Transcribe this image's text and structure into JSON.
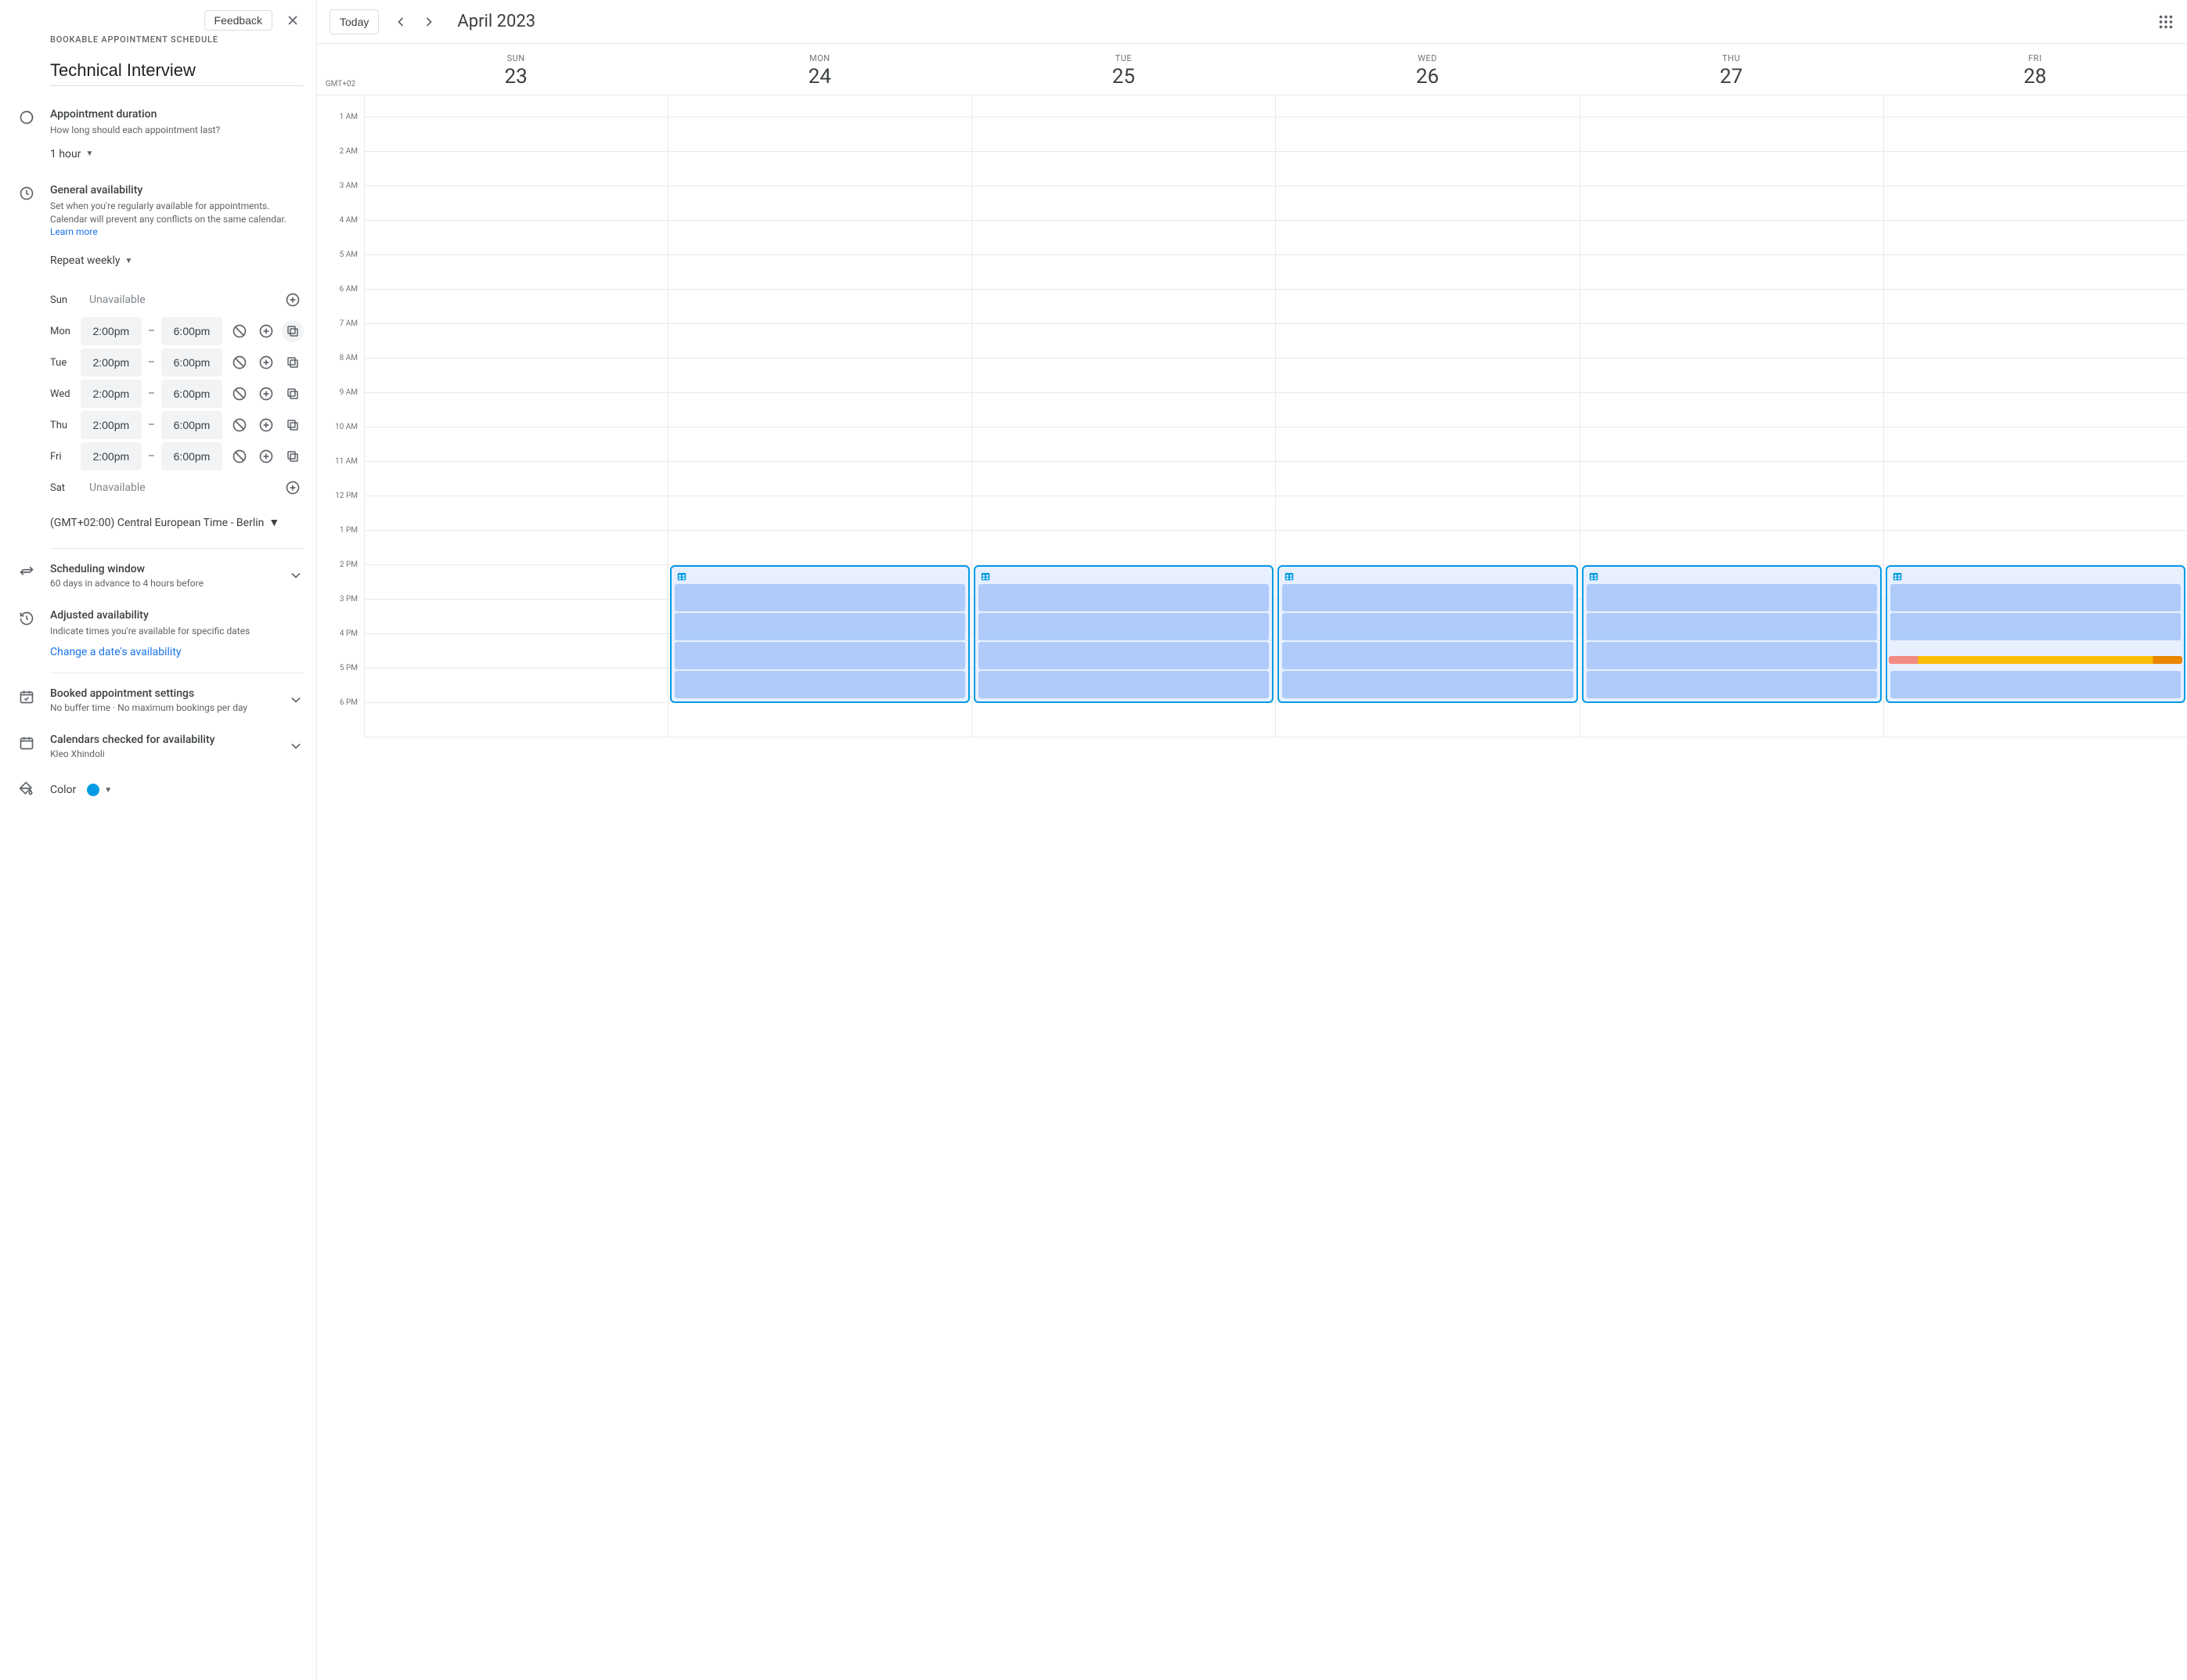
{
  "sidebar": {
    "feedback_label": "Feedback",
    "subhead": "Bookable Appointment Schedule",
    "title": "Technical Interview",
    "duration": {
      "title": "Appointment duration",
      "desc": "How long should each appointment last?",
      "value": "1 hour"
    },
    "availability": {
      "title": "General availability",
      "desc_a": "Set when you're regularly available for appointments. Calendar will prevent any conflicts on the same calendar. ",
      "learn_more": "Learn more",
      "repeat_value": "Repeat weekly",
      "days": [
        {
          "label": "Sun",
          "unavailable": true,
          "unavailable_text": "Unavailable"
        },
        {
          "label": "Mon",
          "start": "2:00pm",
          "end": "6:00pm",
          "copy_highlight": true
        },
        {
          "label": "Tue",
          "start": "2:00pm",
          "end": "6:00pm"
        },
        {
          "label": "Wed",
          "start": "2:00pm",
          "end": "6:00pm"
        },
        {
          "label": "Thu",
          "start": "2:00pm",
          "end": "6:00pm"
        },
        {
          "label": "Fri",
          "start": "2:00pm",
          "end": "6:00pm"
        },
        {
          "label": "Sat",
          "unavailable": true,
          "unavailable_text": "Unavailable"
        }
      ],
      "timezone": "(GMT+02:00) Central European Time - Berlin"
    },
    "scheduling_window": {
      "title": "Scheduling window",
      "desc": "60 days in advance to 4 hours before"
    },
    "adjusted": {
      "title": "Adjusted availability",
      "desc": "Indicate times you're available for specific dates",
      "link": "Change a date's availability"
    },
    "booked": {
      "title": "Booked appointment settings",
      "desc": "No buffer time · No maximum bookings per day"
    },
    "calendars": {
      "title": "Calendars checked for availability",
      "desc": "Kleo Xhindoli"
    },
    "color": {
      "label": "Color",
      "value": "#039be5"
    }
  },
  "topbar": {
    "today_label": "Today",
    "month_label": "April 2023"
  },
  "calendar": {
    "gmt_label": "GMT+02",
    "days": [
      {
        "abbr": "SUN",
        "num": "23",
        "has_block": false
      },
      {
        "abbr": "MON",
        "num": "24",
        "has_block": true
      },
      {
        "abbr": "TUE",
        "num": "25",
        "has_block": true
      },
      {
        "abbr": "WED",
        "num": "26",
        "has_block": true
      },
      {
        "abbr": "THU",
        "num": "27",
        "has_block": true
      },
      {
        "abbr": "FRI",
        "num": "28",
        "has_block": true,
        "gap": true
      }
    ],
    "hours": [
      "",
      "1 AM",
      "2 AM",
      "3 AM",
      "4 AM",
      "5 AM",
      "6 AM",
      "7 AM",
      "8 AM",
      "9 AM",
      "10 AM",
      "11 AM",
      "12 PM",
      "1 PM",
      "2 PM",
      "3 PM",
      "4 PM",
      "5 PM",
      "6 PM"
    ],
    "block_start_hour": 14,
    "block_end_hour": 18
  }
}
